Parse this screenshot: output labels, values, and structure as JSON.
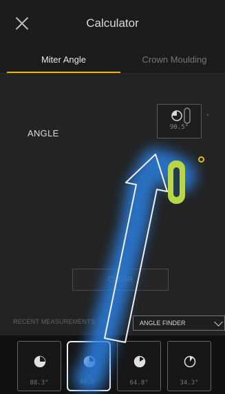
{
  "header": {
    "title": "Calculator",
    "close_icon": "close-icon"
  },
  "tabs": [
    {
      "label": "Miter Angle",
      "active": true
    },
    {
      "label": "Crown Moulding",
      "active": false
    }
  ],
  "angle": {
    "label": "ANGLE",
    "value": "90.5°",
    "degree_symbol": "°"
  },
  "clear_label": "CLEAR",
  "recent": {
    "label": "RECENT MEASUREMENTS",
    "mode": "ANGLE FINDER",
    "items": [
      {
        "value": "88.3°",
        "selected": false
      },
      {
        "value": "90.5°",
        "selected": true
      },
      {
        "value": "64.8°",
        "selected": false
      },
      {
        "value": "34.3°",
        "selected": false
      }
    ]
  },
  "colors": {
    "accent": "#f0b400",
    "glow": "#2a7fe0",
    "highlight": "#b8d645"
  }
}
